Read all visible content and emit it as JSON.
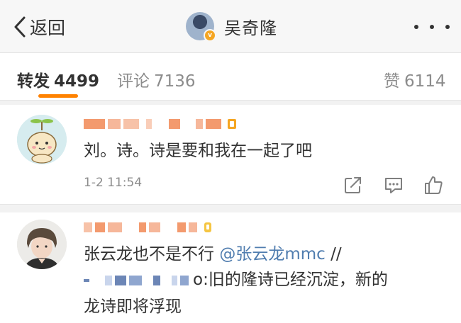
{
  "header": {
    "back_label": "返回",
    "title": "吴奇隆",
    "verified_badge": "v",
    "icons": {
      "back": "chevron-left-icon",
      "more": "more-dots-icon"
    }
  },
  "tabs": {
    "repost": {
      "label": "转发",
      "count": "4499"
    },
    "comment": {
      "label": "评论",
      "count": "7136"
    },
    "like": {
      "label": "赞",
      "count": "6114"
    },
    "active_color": "#ff8200"
  },
  "reposts": [
    {
      "text": "刘。诗。诗是要和我在一起了吧",
      "time": "1-2 11:54",
      "actions": [
        "share-icon",
        "comment-icon",
        "like-icon"
      ]
    },
    {
      "text_before": "张云龙也不是不行",
      "mention": "@张云龙mmc",
      "text_after": " //",
      "quote_tail": "o:旧的隆诗已经沉淀，新的",
      "line3": "龙诗即将浮现"
    }
  ],
  "colors": {
    "mention": "#507daf",
    "accent": "#ff8200",
    "muted": "#8c8c8c",
    "text": "#333333"
  }
}
